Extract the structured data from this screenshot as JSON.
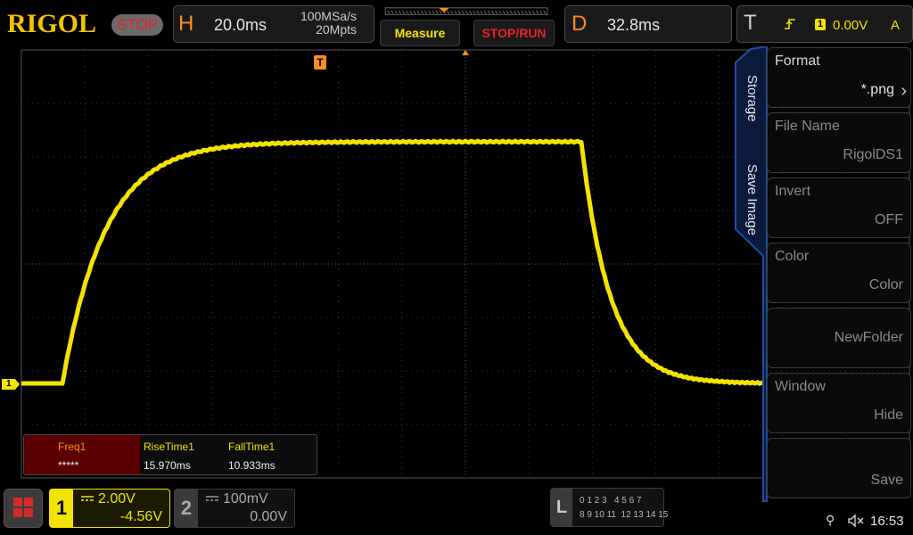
{
  "header": {
    "brand": "RIGOL",
    "run_state": "STOP",
    "horizontal": {
      "letter": "H",
      "timebase": "20.0ms",
      "sample_rate": "100MSa/s",
      "memory_depth": "20Mpts"
    },
    "measure_label": "Measure",
    "stop_run_label": "STOP/RUN",
    "delay": {
      "letter": "D",
      "value": "32.8ms"
    },
    "trigger": {
      "letter": "T",
      "channel": "1",
      "level": "0.00V",
      "mode": "A"
    }
  },
  "trigger_marker": "T",
  "channel_marker": "1",
  "side_menu": {
    "tabs": [
      "Storage",
      "Save Image"
    ],
    "items": [
      {
        "label": "Format",
        "value": "*.png",
        "enabled": true
      },
      {
        "label": "File Name",
        "value": "RigolDS1",
        "enabled": false
      },
      {
        "label": "Invert",
        "value": "OFF",
        "enabled": false
      },
      {
        "label": "Color",
        "value": "Color",
        "enabled": false
      },
      {
        "label": "",
        "value": "NewFolder",
        "enabled": false
      },
      {
        "label": "Window",
        "value": "Hide",
        "enabled": false
      },
      {
        "label": "",
        "value": "Save",
        "enabled": false
      }
    ]
  },
  "measurements": {
    "headers": [
      "Freq1",
      "RiseTime1",
      "FallTime1"
    ],
    "values": [
      "*****",
      "15.970ms",
      "10.933ms"
    ]
  },
  "footer": {
    "ch1": {
      "number": "1",
      "scale": "2.00V",
      "offset": "-4.56V"
    },
    "ch2": {
      "number": "2",
      "scale": "100mV",
      "offset": "0.00V"
    },
    "logic": {
      "letter": "L",
      "row1": "0 1 2 3   4 5 6 7",
      "row2": "8 9 10 11  12 13 14 15"
    },
    "time": "16:53"
  },
  "colors": {
    "ch1": "#f2e400",
    "accent": "#ff8c1a",
    "stop": "#e8232a",
    "menu_blue": "#1f4fa0"
  }
}
